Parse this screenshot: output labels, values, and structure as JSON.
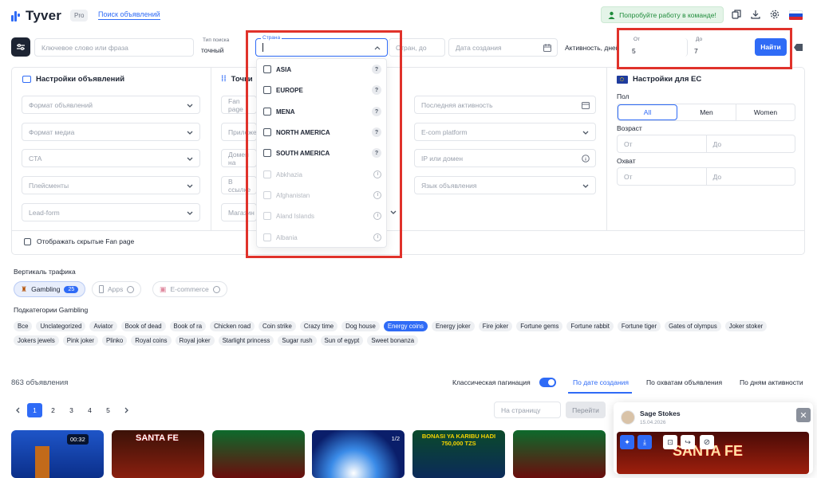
{
  "topbar": {
    "brand": "Tyver",
    "badge": "Pro",
    "nav_link": "Поиск объявлений",
    "team_button": "Попробуйте работу в команде!"
  },
  "search": {
    "keyword_placeholder": "Ключевое слово или фраза",
    "search_type_label": "Тип поиска",
    "search_type_value": "точный",
    "country_label": "Страна",
    "pages_placeholder": "Стран, до",
    "date_placeholder": "Дата создания",
    "activity_label": "Активность, дней",
    "from_label": "От",
    "from_value": "5",
    "to_label": "До",
    "to_value": "7",
    "find_button": "Найти"
  },
  "country_dropdown": {
    "regions": [
      "ASIA",
      "EUROPE",
      "MENA",
      "NORTH AMERICA",
      "SOUTH AMERICA"
    ],
    "countries": [
      "Abkhazia",
      "Afghanistan",
      "Aland Islands",
      "Albania"
    ]
  },
  "ad_settings": {
    "title": "Настройки объявлений",
    "col1": [
      "Формат объявлений",
      "Формат медиа",
      "CTA",
      "Плейсменты",
      "Lead-form"
    ],
    "col2_title": "Точки",
    "col2": [
      "Fan page",
      "Приложение",
      "Домен на",
      "В ссылке",
      "Магазин"
    ],
    "col3": [
      "Последняя активность",
      "E-com platform",
      "IP или домен",
      "Язык объявления"
    ],
    "hidden_fanpage": "Отображать скрытые Fan page"
  },
  "eu_settings": {
    "title": "Настройки для ЕС",
    "gender_label": "Пол",
    "genders": [
      "All",
      "Men",
      "Women"
    ],
    "age_label": "Возраст",
    "reach_label": "Охват",
    "from": "От",
    "to": "До"
  },
  "verticals": {
    "label": "Вертикаль трафика",
    "items": [
      {
        "label": "Gambling",
        "count": "25"
      },
      {
        "label": "Apps"
      },
      {
        "label": "E-commerce"
      }
    ]
  },
  "subcategories": {
    "label": "Подкатегории Gambling",
    "tags": [
      "Все",
      "Unclategorized",
      "Aviator",
      "Book of dead",
      "Book of ra",
      "Chicken road",
      "Coin strike",
      "Crazy time",
      "Dog house",
      "Energy coins",
      "Energy joker",
      "Fire joker",
      "Fortune gems",
      "Fortune rabbit",
      "Fortune tiger",
      "Gates of olympus",
      "Joker stoker",
      "Jokers jewels",
      "Pink joker",
      "Plinko",
      "Royal coins",
      "Royal joker",
      "Starlight princess",
      "Sugar rush",
      "Sun of egypt",
      "Sweet bonanza"
    ],
    "active": "Energy coins"
  },
  "results": {
    "count": "863 объявления",
    "classic_pagination": "Классическая пагинация",
    "sorts": [
      "По дате создания",
      "По охватам объявления",
      "По дням активности"
    ],
    "pages": [
      "1",
      "2",
      "3",
      "4",
      "5"
    ],
    "per_page_placeholder": "На страницу",
    "go_button": "Перейти"
  },
  "cards": [
    {
      "overlay": "00:32"
    },
    {
      "overlay": "SANTA FE"
    },
    {
      "overlay": ""
    },
    {
      "overlay": "1/2"
    },
    {
      "overlay": "BONASI YA KARIBU HADI 750,000 TZS"
    },
    {
      "overlay": ""
    }
  ],
  "popup": {
    "name": "Sage Stokes",
    "date": "15.04.2026",
    "banner": "SANTA FE"
  },
  "colors": {
    "accent": "#2f6bf6",
    "highlight": "#e0322b",
    "success": "#1f8c3b"
  }
}
